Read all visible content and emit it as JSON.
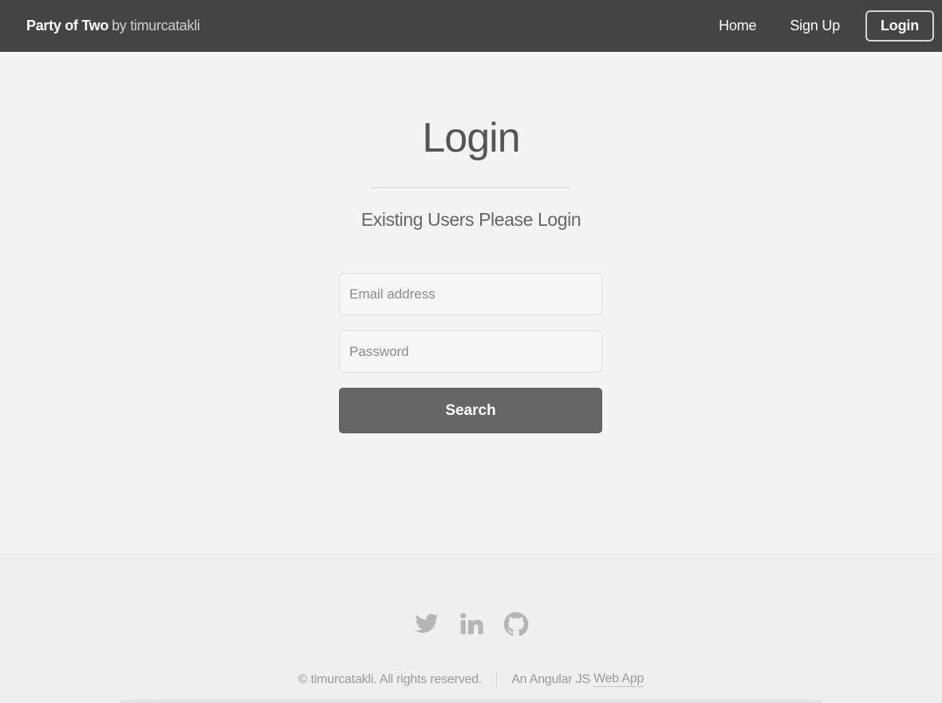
{
  "header": {
    "brand_name": "Party of Two",
    "brand_by": "by timurcatakli",
    "nav": [
      {
        "label": "Home"
      },
      {
        "label": "Sign Up"
      },
      {
        "label": "Login",
        "active": true
      }
    ]
  },
  "main": {
    "title": "Login",
    "subtitle": "Existing Users Please Login",
    "email_placeholder": "Email address",
    "password_placeholder": "Password",
    "submit_label": "Search"
  },
  "footer": {
    "social": [
      "twitter-icon",
      "linkedin-icon",
      "github-icon"
    ],
    "copyright": "© timurcatakli. All rights reserved.",
    "app_prefix": "An Angular JS",
    "app_link": "Web App"
  },
  "colors": {
    "header_bg": "#444444",
    "page_bg": "#f4f4f4",
    "footer_bg": "#efefef",
    "button_bg": "#666666",
    "icon": "#b5b5b5"
  }
}
